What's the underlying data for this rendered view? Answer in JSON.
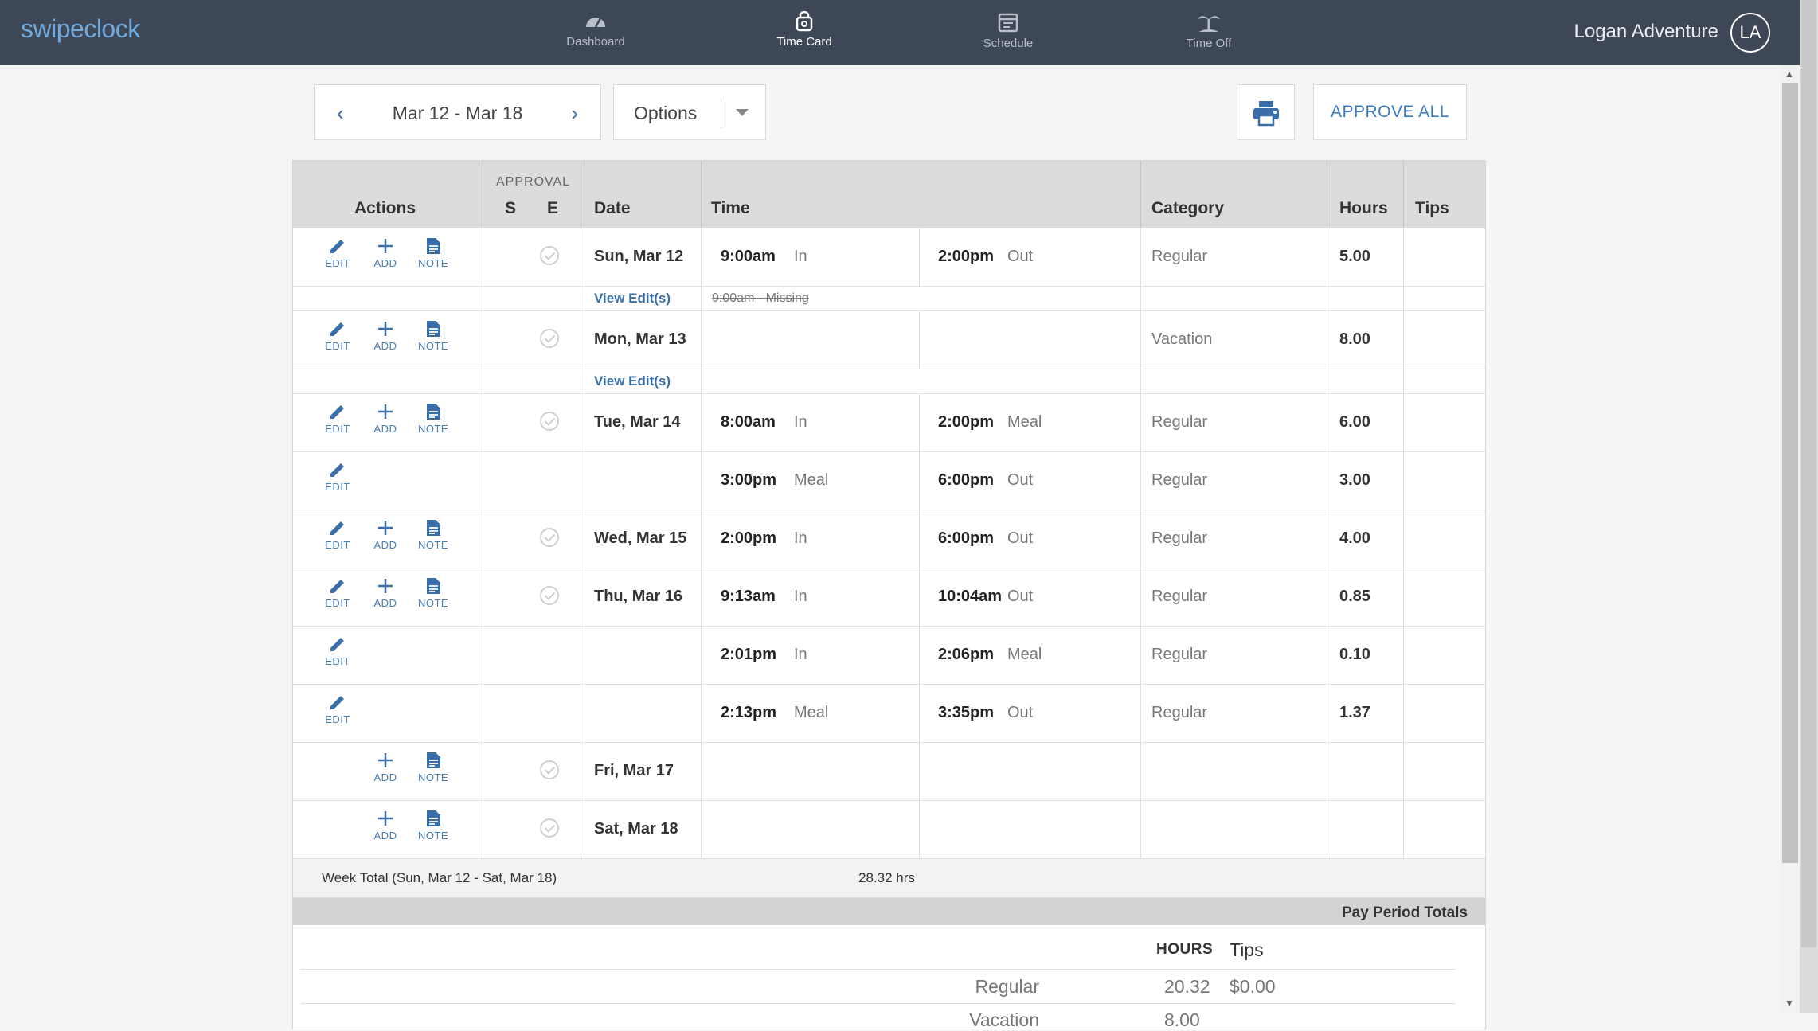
{
  "app": {
    "logo": "swipeclock"
  },
  "nav": [
    {
      "label": "Dashboard",
      "icon": "dashboard-gauge-icon"
    },
    {
      "label": "Time Card",
      "icon": "timecard-lock-icon",
      "active": true
    },
    {
      "label": "Schedule",
      "icon": "calendar-icon"
    },
    {
      "label": "Time Off",
      "icon": "palm-tree-icon"
    }
  ],
  "user": {
    "name": "Logan Adventure",
    "initials": "LA"
  },
  "toolbar": {
    "date_range": "Mar 12 - Mar 18",
    "options_label": "Options",
    "approve_all": "APPROVE ALL"
  },
  "table": {
    "headers": {
      "actions": "Actions",
      "approval": "APPROVAL",
      "s": "S",
      "e": "E",
      "date": "Date",
      "time": "Time",
      "category": "Category",
      "hours": "Hours",
      "tips": "Tips"
    },
    "action_labels": {
      "edit": "EDIT",
      "add": "ADD",
      "note": "NOTE"
    },
    "rows": [
      {
        "date": "Sun, Mar 12",
        "t1": "9:00am",
        "t1l": "In",
        "t2": "2:00pm",
        "t2l": "Out",
        "cat": "Regular",
        "hrs": "5.00"
      },
      {
        "view_edits": "View Edit(s)",
        "strike": "9:00am - Missing"
      },
      {
        "date": "Mon, Mar 13",
        "t1": "",
        "t1l": "",
        "t2": "",
        "t2l": "",
        "cat": "Vacation",
        "hrs": "8.00"
      },
      {
        "view_edits": "View Edit(s)",
        "strike": ""
      },
      {
        "date": "Tue, Mar 14",
        "t1": "8:00am",
        "t1l": "In",
        "t2": "2:00pm",
        "t2l": "Meal",
        "cat": "Regular",
        "hrs": "6.00"
      },
      {
        "date": "",
        "t1": "3:00pm",
        "t1l": "Meal",
        "t2": "6:00pm",
        "t2l": "Out",
        "cat": "Regular",
        "hrs": "3.00"
      },
      {
        "date": "Wed, Mar 15",
        "t1": "2:00pm",
        "t1l": "In",
        "t2": "6:00pm",
        "t2l": "Out",
        "cat": "Regular",
        "hrs": "4.00"
      },
      {
        "date": "Thu, Mar 16",
        "t1": "9:13am",
        "t1l": "In",
        "t2": "10:04am",
        "t2l": "Out",
        "cat": "Regular",
        "hrs": "0.85"
      },
      {
        "date": "",
        "t1": "2:01pm",
        "t1l": "In",
        "t2": "2:06pm",
        "t2l": "Meal",
        "cat": "Regular",
        "hrs": "0.10"
      },
      {
        "date": "",
        "t1": "2:13pm",
        "t1l": "Meal",
        "t2": "3:35pm",
        "t2l": "Out",
        "cat": "Regular",
        "hrs": "1.37"
      },
      {
        "date": "Fri, Mar 17",
        "t1": "",
        "t1l": "",
        "t2": "",
        "t2l": "",
        "cat": "",
        "hrs": ""
      },
      {
        "date": "Sat, Mar 18",
        "t1": "",
        "t1l": "",
        "t2": "",
        "t2l": "",
        "cat": "",
        "hrs": ""
      }
    ],
    "week_total": {
      "label": "Week Total (Sun, Mar 12 - Sat, Mar 18)",
      "value": "28.32 hrs"
    }
  },
  "pay_period": {
    "title": "Pay Period Totals",
    "hours_header": "HOURS",
    "tips_header": "Tips",
    "rows": [
      {
        "label": "Regular",
        "hours": "20.32",
        "tips": "$0.00"
      },
      {
        "label": "Vacation",
        "hours": "8.00",
        "tips": ""
      }
    ]
  }
}
